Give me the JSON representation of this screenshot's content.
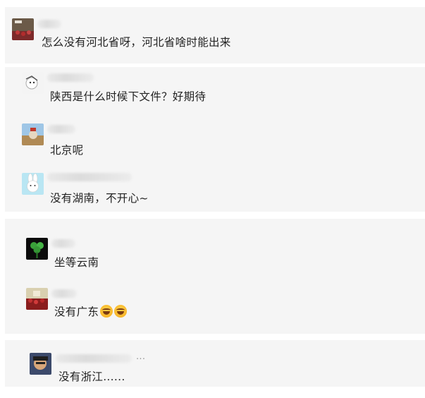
{
  "comments": [
    {
      "text": "怎么没有河北省呀，河北省啥时能出来"
    },
    {
      "text": "陕西是什么时候下文件？好期待"
    },
    {
      "text": "北京呢"
    },
    {
      "text": "没有湖南，不开心~"
    },
    {
      "text": "坐等云南"
    },
    {
      "text": "没有广东",
      "emoji": [
        "grinning-tears-emoji",
        "grinning-tears-emoji"
      ]
    },
    {
      "text": "没有浙江......"
    }
  ],
  "name_partial": "...",
  "colors": {
    "card_background": "#f5f5f5",
    "text": "#222222"
  }
}
